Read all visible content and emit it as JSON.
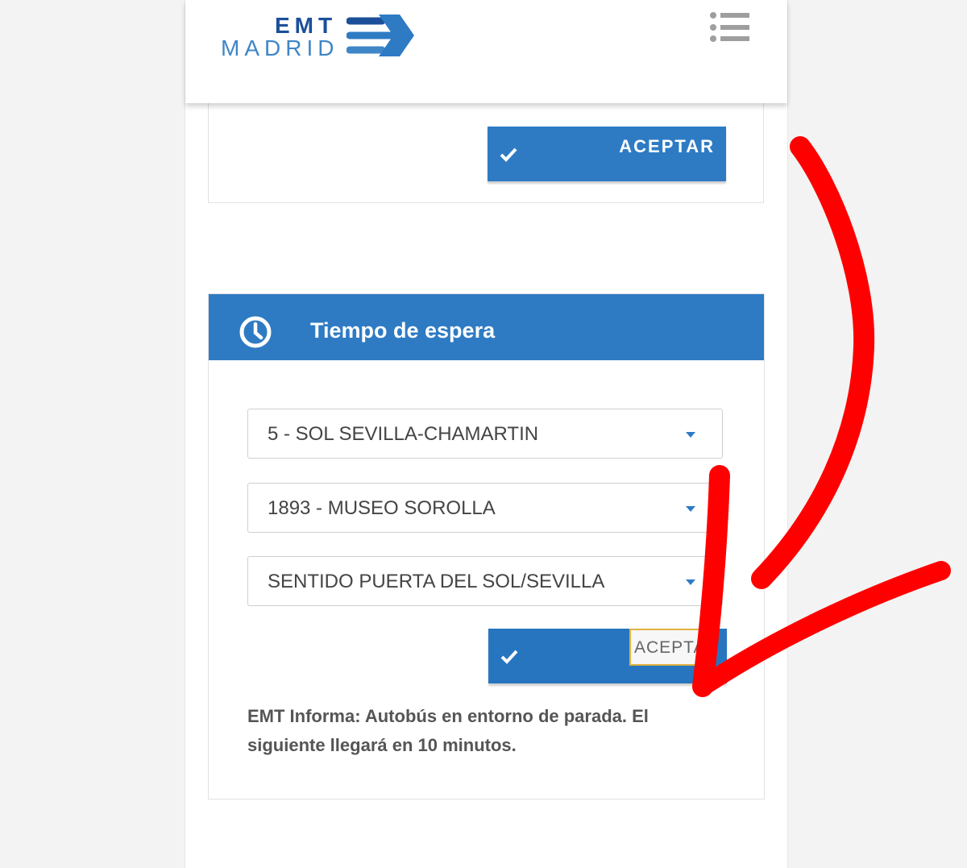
{
  "header": {
    "logo_emt": "EMT",
    "logo_madrid": "MADRID",
    "menu_icon": "list-menu-icon"
  },
  "top_card": {
    "button_label": "ACEPTAR",
    "button_icon": "checkmark-icon"
  },
  "wait_card": {
    "title": "Tiempo de espera",
    "title_icon": "clock-icon",
    "line_select": "5 - SOL SEVILLA-CHAMARTIN",
    "stop_select": "1893 - MUSEO SOROLLA",
    "direction_select": "SENTIDO PUERTA DEL SOL/SEVILLA",
    "button_label": "ACEPTAR",
    "info_text": "EMT Informa: Autobús en entorno de parada. El siguiente llegará en 10 minutos."
  },
  "colors": {
    "brand_blue": "#2e7bc4",
    "logo_dark": "#1c4f9a",
    "logo_light": "#3f86c7",
    "annotation_red": "#ff0000"
  }
}
